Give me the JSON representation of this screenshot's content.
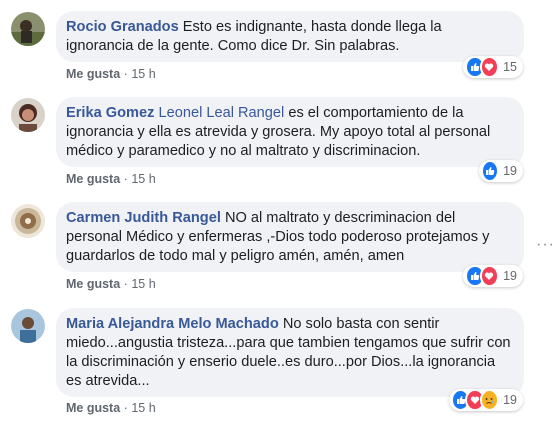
{
  "more_menu": "···",
  "comments": [
    {
      "author": "Rocio Granados",
      "mention": "",
      "text": "Esto es indignante, hasta donde llega la ignorancia de la gente. Como dice Dr. Sin palabras.",
      "like_label": "Me gusta",
      "separator": "·",
      "time": "15 h",
      "reactions": [
        "like-icon",
        "love-icon"
      ],
      "reaction_count": "15"
    },
    {
      "author": "Erika Gomez",
      "mention": "Leonel Leal Rangel",
      "text": "es el comportamiento de la ignorancia y ella es atrevida y grosera. My apoyo total al personal médico y paramedico y no al maltrato y discriminacion.",
      "like_label": "Me gusta",
      "separator": "·",
      "time": "15 h",
      "reactions": [
        "like-icon"
      ],
      "reaction_count": "19"
    },
    {
      "author": "Carmen Judith Rangel",
      "mention": "",
      "text": "NO al maltrato y descriminacion del personal Médico y enfermeras ,-Dios todo poderoso protejamos y guardarlos de todo mal y peligro amén, amén, amen",
      "like_label": "Me gusta",
      "separator": "·",
      "time": "15 h",
      "reactions": [
        "like-icon",
        "love-icon"
      ],
      "reaction_count": "19"
    },
    {
      "author": "Maria Alejandra Melo Machado",
      "mention": "",
      "text": "No solo basta con sentir miedo...angustia tristeza...para que tambien tengamos que sufrir con la discriminación y enserio duele..es duro...por Dios...la ignorancia es atrevida...",
      "like_label": "Me gusta",
      "separator": "·",
      "time": "15 h",
      "reactions": [
        "like-icon",
        "love-icon",
        "sad-icon"
      ],
      "reaction_count": "19"
    }
  ]
}
